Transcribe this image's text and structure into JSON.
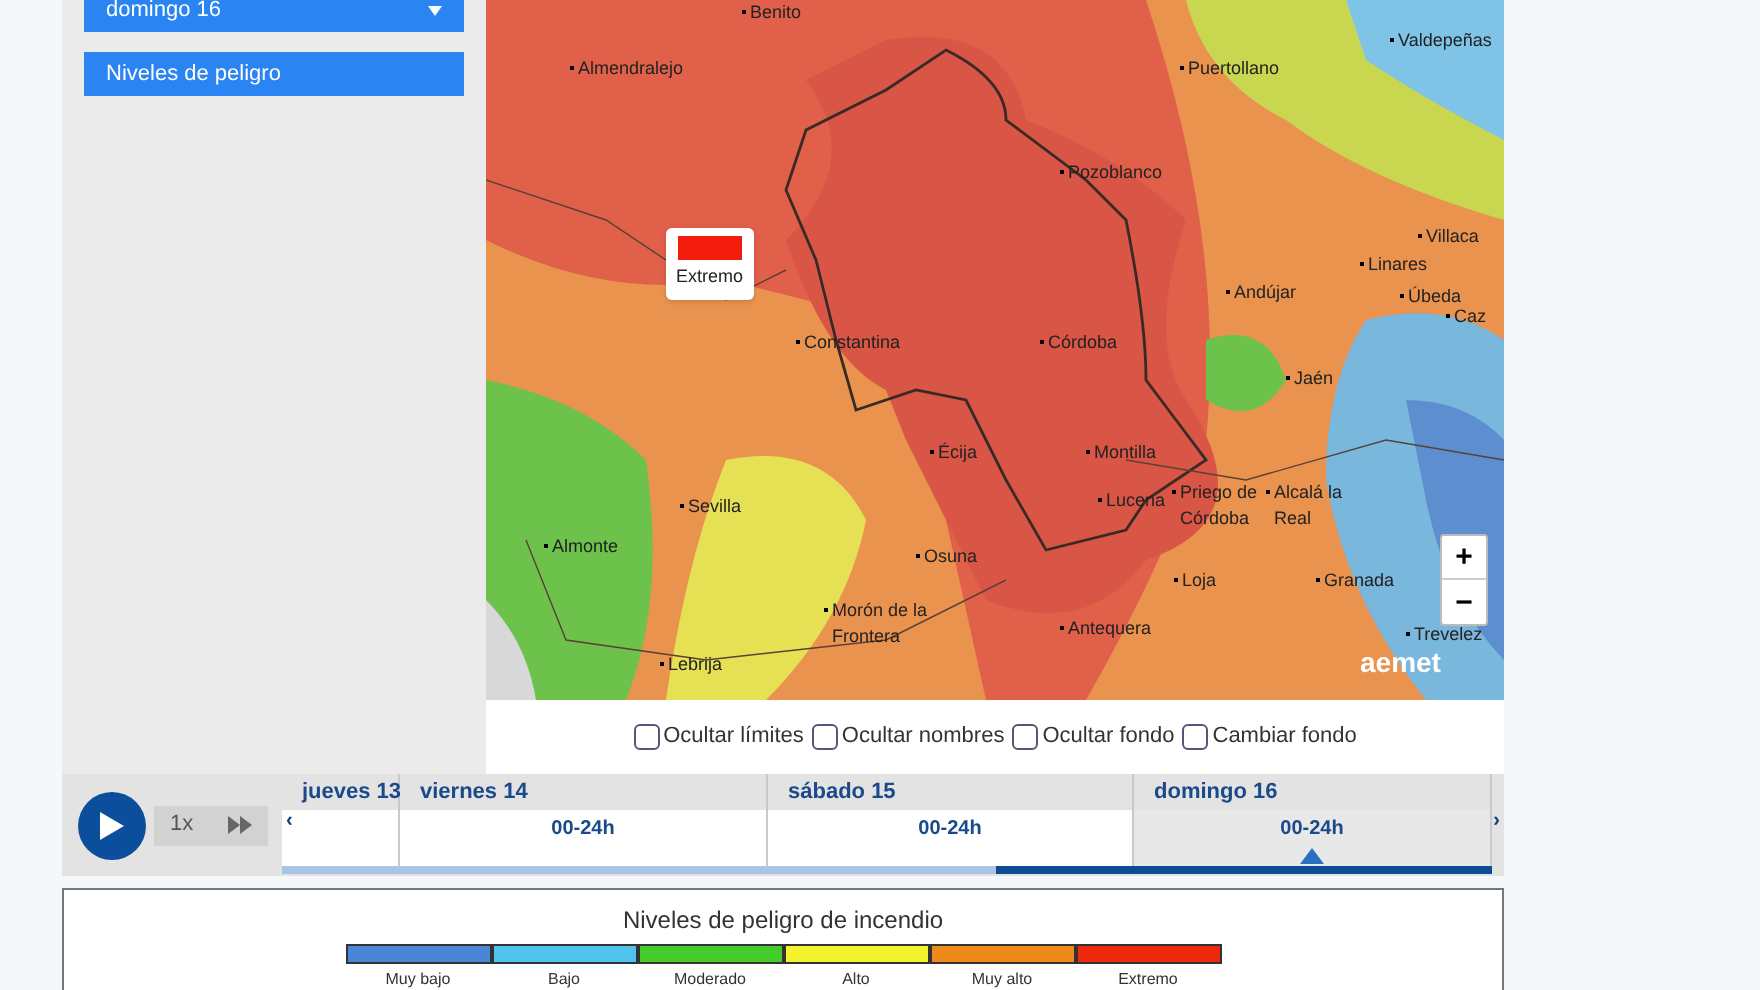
{
  "sidebar": {
    "day_select": "domingo 16",
    "layer_button": "Niveles de peligro"
  },
  "map": {
    "places": [
      "Benito",
      "Valdepeñas",
      "Almendralejo",
      "Puertollano",
      "Pozoblanco",
      "Villaca",
      "Linares",
      "Andújar",
      "Úbeda",
      "Caz",
      "Constantina",
      "Córdoba",
      "Jaén",
      "Écija",
      "Montilla",
      "Sevilla",
      "Lucena",
      "Priego de Córdoba",
      "Alcalá la Real",
      "Almonte",
      "Osuna",
      "Loja",
      "Granada",
      "Morón de la Frontera",
      "Antequera",
      "Trevelez",
      "Lebrija"
    ],
    "popup": {
      "label": "Extremo",
      "color": "#f21b0c"
    },
    "zoom_in": "+",
    "zoom_out": "−",
    "logo": "aemet"
  },
  "options": [
    {
      "label": "Ocultar límites",
      "checked": false
    },
    {
      "label": "Ocultar nombres",
      "checked": false
    },
    {
      "label": "Ocultar fondo",
      "checked": false
    },
    {
      "label": "Cambiar fondo",
      "checked": false
    }
  ],
  "player": {
    "speed": "1x",
    "playing": false
  },
  "timeline": {
    "prev": "‹",
    "next": "›",
    "level": 0.41,
    "days": [
      {
        "label": "jueves 13",
        "selected": false
      },
      {
        "label": "viernes 14",
        "period": "00-24h",
        "selected": false
      },
      {
        "label": "sábado 15",
        "period": "00-24h",
        "selected": false
      },
      {
        "label": "domingo 16",
        "period": "00-24h",
        "selected": true
      }
    ]
  },
  "legend": {
    "title": "Niveles de peligro de incendio",
    "levels": [
      {
        "label": "Muy bajo",
        "color": "#4a86d8"
      },
      {
        "label": "Bajo",
        "color": "#4fc3ee"
      },
      {
        "label": "Moderado",
        "color": "#44cc2c"
      },
      {
        "label": "Alto",
        "color": "#f4f22e"
      },
      {
        "label": "Muy alto",
        "color": "#ee8a1c"
      },
      {
        "label": "Extremo",
        "color": "#ee2a0e"
      }
    ]
  }
}
